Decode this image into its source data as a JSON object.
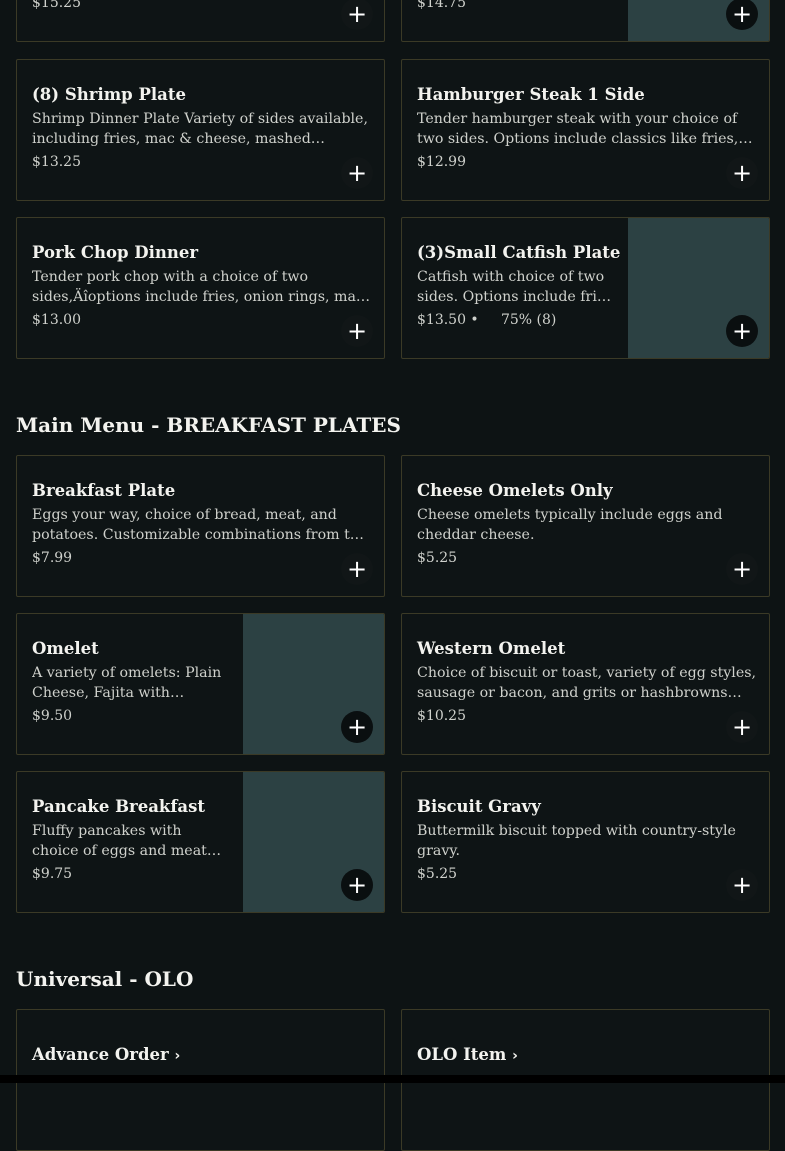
{
  "top_row": [
    {
      "price": "$15.25"
    },
    {
      "price": "$14.75"
    }
  ],
  "row_a": [
    {
      "name": "(8) Shrimp Plate",
      "desc": "Shrimp Dinner Plate Variety of sides available, including fries, mac & cheese, mashed potatoes, and more.",
      "price": "$13.25"
    },
    {
      "name": "Hamburger Steak 1 Side",
      "desc": "Tender hamburger steak with your choice of two sides. Options include classics like fries, mac & cheese, and more.",
      "price": "$12.99"
    }
  ],
  "row_b": [
    {
      "name": "Pork Chop Dinner",
      "desc": "Tender pork chop with a choice of two sides,Äîoptions include fries, onion rings, mac & cheese, and more.",
      "price": "$13.00"
    },
    {
      "name": "(3)Small Catfish Plate",
      "desc": "Catfish with choice of two sides. Options include fries and more.",
      "price": "$13.50 •     75% (8)"
    }
  ],
  "sections": {
    "breakfast": "Main Menu - BREAKFAST PLATES",
    "olo": "Universal - OLO"
  },
  "breakfast": [
    {
      "name": "Breakfast Plate",
      "desc": "Eggs your way, choice of bread, meat, and potatoes. Customizable combinations from the menu.",
      "price": "$7.99"
    },
    {
      "name": "Cheese Omelets Only",
      "desc": "Cheese omelets typically include eggs and cheddar cheese.",
      "price": "$5.25"
    },
    {
      "name": "Omelet",
      "desc": "A variety of omelets: Plain Cheese, Fajita with peppers and onions, and more.",
      "price": "$9.50"
    },
    {
      "name": "Western Omelet",
      "desc": "Choice of biscuit or toast, variety of egg styles, sausage or bacon, and grits or hashbrowns with more.",
      "price": "$10.25"
    },
    {
      "name": "Pancake Breakfast",
      "desc": "Fluffy pancakes with choice of eggs and meats. Egg styles available.",
      "price": "$9.75"
    },
    {
      "name": "Biscuit Gravy",
      "desc": "Buttermilk biscuit topped with country-style gravy.",
      "price": "$5.25"
    }
  ],
  "olo": [
    {
      "name": "Advance Order",
      "chevron": "›"
    },
    {
      "name": "OLO Item",
      "chevron": "›"
    }
  ],
  "add_symbol": "+"
}
